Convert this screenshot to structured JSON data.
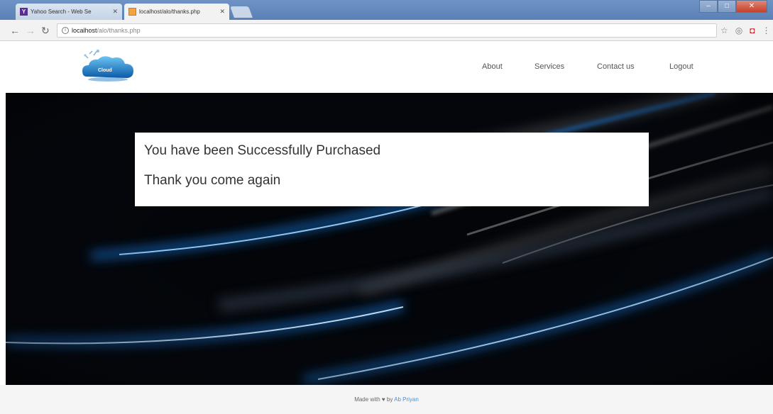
{
  "browser": {
    "tabs": [
      {
        "title": "Yahoo Search - Web Se",
        "favicon": "Y",
        "active": false
      },
      {
        "title": "localhost/alo/thanks.php",
        "active": true
      }
    ],
    "url_host": "localhost",
    "url_path": "/alo/thanks.php",
    "window_controls": {
      "minimize": "–",
      "maximize": "□",
      "close": "✕"
    }
  },
  "site": {
    "logo_text": "Cloud",
    "nav": {
      "about": "About",
      "services": "Services",
      "contact": "Contact us",
      "logout": "Logout"
    },
    "message": {
      "line1": "You have been Successfully Purchased",
      "line2": "Thank you come again"
    },
    "footer": {
      "prefix": "Made with",
      "heart": "♥",
      "by": "by",
      "author": "Ab Priyan"
    }
  },
  "colors": {
    "hero_bg": "#000000",
    "streak_blue": "#1a8cff",
    "link_blue": "#4a90d9",
    "footer_bg": "#f5f5f5"
  }
}
